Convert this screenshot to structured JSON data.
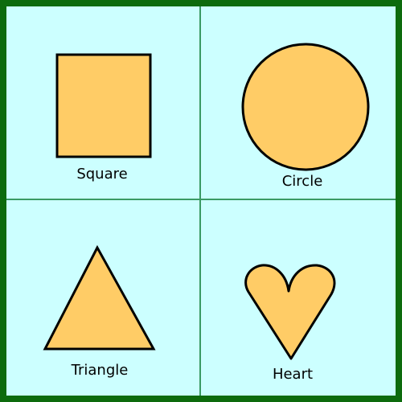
{
  "colors": {
    "frame": "#0d6b0d",
    "cell_background": "#ccffff",
    "divider": "#3b9a64",
    "shape_fill": "#ffcc66",
    "shape_stroke": "#000000"
  },
  "cells": [
    {
      "shape": "square",
      "label": "Square"
    },
    {
      "shape": "circle",
      "label": "Circle"
    },
    {
      "shape": "triangle",
      "label": "Triangle"
    },
    {
      "shape": "heart",
      "label": "Heart"
    }
  ]
}
